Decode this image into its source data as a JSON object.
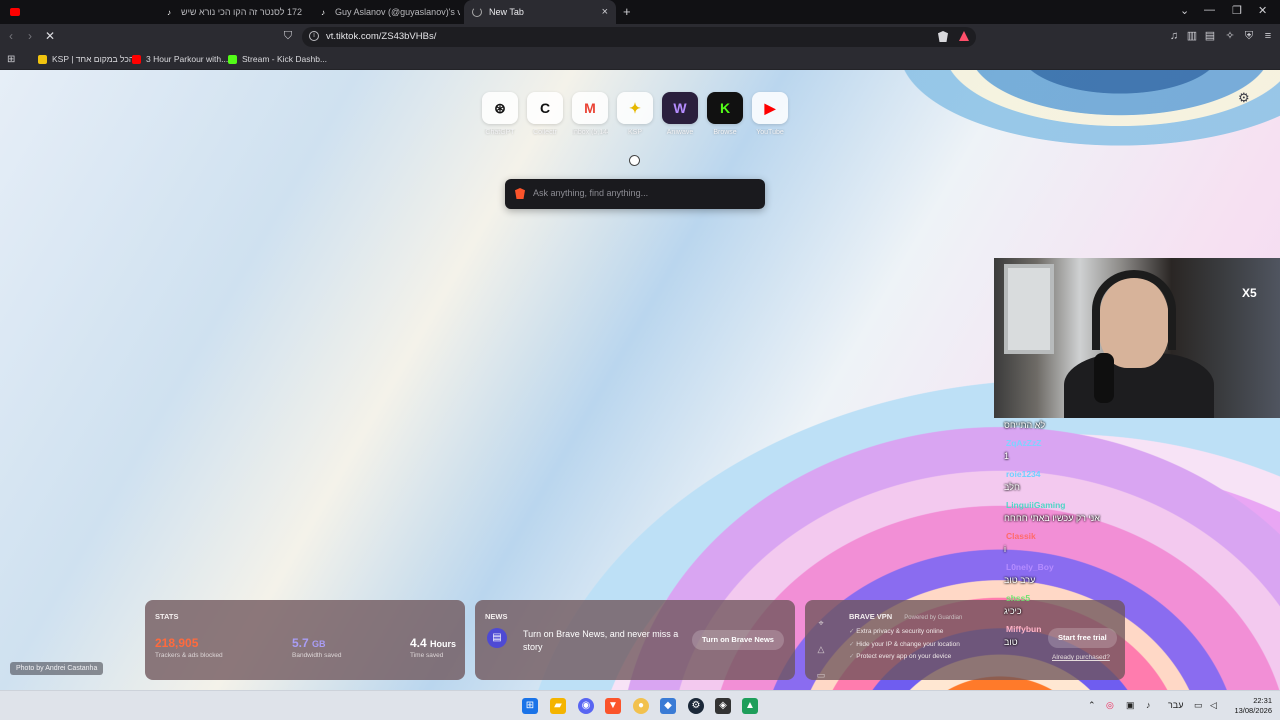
{
  "browser": {
    "tabs": [
      {
        "label": "קו 172 לסנטר זה הקו הכי נורא שיש!!",
        "favicon": "tiktok-icon",
        "active": false
      },
      {
        "label": "Guy Aslanov (@guyaslanov)'s videos",
        "favicon": "tiktok-icon",
        "active": false
      },
      {
        "label": "New Tab",
        "favicon": "loading-icon",
        "active": true
      }
    ],
    "new_tab_symbol": "+",
    "close_tab_symbol": "×",
    "url": "vt.tiktok.com/ZS43bVHBs/",
    "reload_symbol": "✕"
  },
  "bookmarks": [
    {
      "label": "KSP | הכל במקום אחד",
      "icon": "ksp-icon",
      "color": "#f1c40f"
    },
    {
      "label": "3 Hour Parkour with...",
      "icon": "youtube-icon",
      "color": "#ff0000"
    },
    {
      "label": "Stream - Kick Dashb...",
      "icon": "kick-icon",
      "color": "#53fc18"
    }
  ],
  "new_tab_page": {
    "top_sites": [
      {
        "label": "ChatGPT",
        "glyph": "⊛",
        "color": "#111111"
      },
      {
        "label": "Collectr",
        "glyph": "C",
        "color": "#111111"
      },
      {
        "label": "Inbox (5,144)",
        "glyph": "M",
        "color": "#ea4335"
      },
      {
        "label": "KSP",
        "glyph": "✦",
        "color": "#e6b800"
      },
      {
        "label": "Aniwave",
        "glyph": "W",
        "color": "#9b59ff"
      },
      {
        "label": "Browse",
        "glyph": "K",
        "color": "#53fc18"
      },
      {
        "label": "YouTube",
        "glyph": "▶",
        "color": "#ff0000"
      }
    ],
    "search_placeholder": "Ask anything, find anything...",
    "photo_credit": "Photo by Andrei Castanha",
    "stats": {
      "title": "STATS",
      "items": [
        {
          "value": "218,905",
          "unit": "",
          "label": "Trackers & ads blocked",
          "color": "#ff6a3d"
        },
        {
          "value": "5.7",
          "unit": "GB",
          "label": "Bandwidth saved",
          "color": "#a99df5"
        },
        {
          "value": "4.4",
          "unit": "Hours",
          "label": "Time saved",
          "color": "#ffffff"
        }
      ]
    },
    "news": {
      "title": "NEWS",
      "text": "Turn on Brave News, and never miss a story",
      "button": "Turn on Brave News"
    },
    "vpn": {
      "title": "BRAVE VPN",
      "powered_by": "Powered by Guardian",
      "features": [
        "Extra privacy & security online",
        "Hide your IP & change your location",
        "Protect every app on your device"
      ],
      "button": "Start free trial",
      "link": "Already purchased?"
    }
  },
  "stream_overlay": {
    "badge": "X5",
    "chat": [
      {
        "user": "",
        "message": "לא התייחס",
        "color": "#ffffff"
      },
      {
        "user": "ZqAzZzZ",
        "message": "1",
        "color": "#7fd3ff"
      },
      {
        "user": "roie1234",
        "message": "חלב",
        "color": "#6fd1ff"
      },
      {
        "user": "LinguiiGaming",
        "message": "אני רק עכשיו באתי חחחח",
        "color": "#4fd6c6"
      },
      {
        "user": "Classik",
        "message": "i",
        "color": "#ff6a6a"
      },
      {
        "user": "L0nely_Boy",
        "message": "ערב טוב",
        "color": "#b58cff"
      },
      {
        "user": "shss5",
        "message": "כיכיג",
        "color": "#6fe36f"
      },
      {
        "user": "Miffybun",
        "message": "טוב",
        "color": "#ffb3c8"
      }
    ]
  },
  "taskbar": {
    "language": "עבר",
    "time": "22:31",
    "date": "13/08/2026"
  }
}
